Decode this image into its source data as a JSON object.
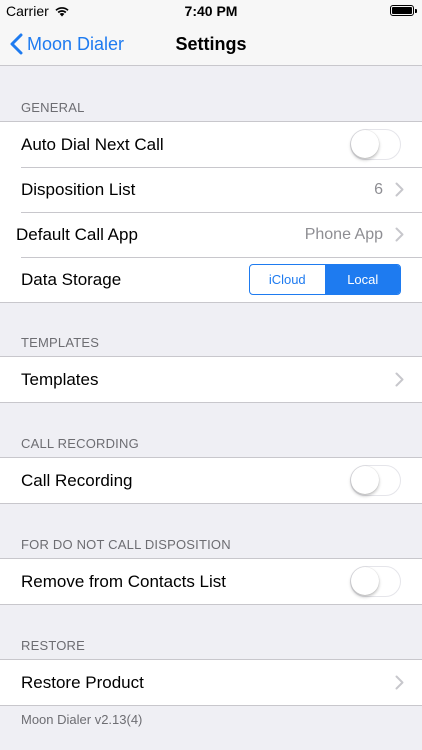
{
  "status_bar": {
    "carrier": "Carrier",
    "time": "7:40 PM"
  },
  "nav": {
    "back_label": "Moon Dialer",
    "title": "Settings"
  },
  "sections": {
    "general": {
      "header": "GENERAL",
      "auto_dial_label": "Auto Dial Next Call",
      "auto_dial_on": false,
      "disposition_label": "Disposition List",
      "disposition_value": "6",
      "default_app_label": "Default Call App",
      "default_app_value": "Phone App",
      "storage_label": "Data Storage",
      "storage_options": [
        "iCloud",
        "Local"
      ],
      "storage_selected": "Local"
    },
    "templates": {
      "header": "TEMPLATES",
      "row_label": "Templates"
    },
    "call_recording": {
      "header": "CALL RECORDING",
      "row_label": "Call Recording",
      "enabled": false
    },
    "dnc": {
      "header": "FOR DO NOT CALL DISPOSITION",
      "row_label": "Remove from Contacts List",
      "enabled": false
    },
    "restore": {
      "header": "RESTORE",
      "row_label": "Restore Product"
    }
  },
  "footer": {
    "version": "Moon Dialer v2.13(4)"
  },
  "colors": {
    "accent": "#1e7bf0",
    "background": "#efeff4",
    "separator": "#c8c7cc",
    "secondary_text": "#8e8e93"
  },
  "icons": {
    "wifi": "wifi-icon",
    "battery": "battery-icon",
    "back": "chevron-left-icon",
    "disclosure": "chevron-right-icon"
  }
}
